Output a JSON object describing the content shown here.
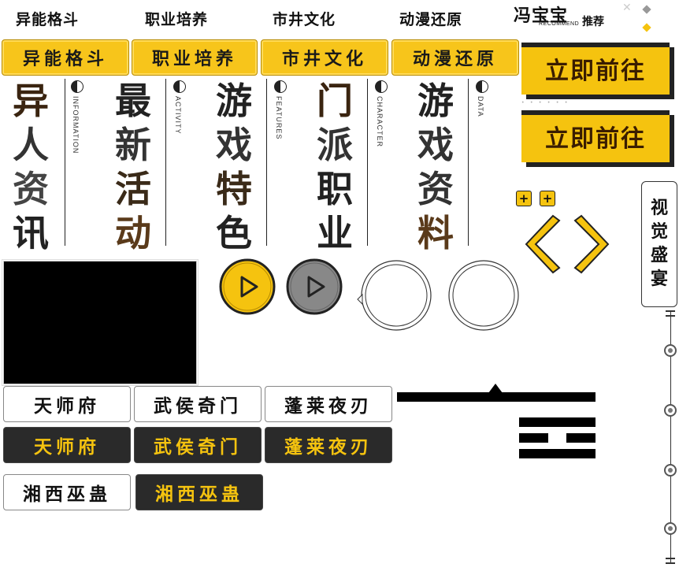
{
  "top_nav": {
    "items": [
      "异能格斗",
      "职业培养",
      "市井文化",
      "动漫还原"
    ]
  },
  "brand": {
    "name": "冯宝宝",
    "sub": "RECOMMEND",
    "tag": "推荐"
  },
  "tabs": {
    "items": [
      "异能格斗",
      "职业培养",
      "市井文化",
      "动漫还原"
    ]
  },
  "actions": {
    "go_primary": "立即前往",
    "go_secondary": "立即前往"
  },
  "categories": [
    {
      "title": [
        "异",
        "人",
        "资",
        "讯"
      ],
      "label": "INFORMATION"
    },
    {
      "title": [
        "最",
        "新",
        "活",
        "动"
      ],
      "label": "ACTIVITY"
    },
    {
      "title": [
        "游",
        "戏",
        "特",
        "色"
      ],
      "label": "FEATURES"
    },
    {
      "title": [
        "门",
        "派",
        "职",
        "业"
      ],
      "label": "CHARACTER"
    },
    {
      "title": [
        "游",
        "戏",
        "资",
        "料"
      ],
      "label": "DATA"
    }
  ],
  "visual_feast": {
    "chars": [
      "视",
      "觉",
      "盛",
      "宴"
    ]
  },
  "sects": {
    "light_row": [
      "天师府",
      "武侯奇门",
      "蓬莱夜刃"
    ],
    "dark_row": [
      "天师府",
      "武侯奇门",
      "蓬莱夜刃"
    ],
    "light_single": "湘西巫蛊",
    "dark_single": "湘西巫蛊"
  },
  "icons": {
    "plus": "plus-icon",
    "prev": "chevron-left-icon",
    "next": "chevron-right-icon",
    "play": "play-icon",
    "yin_yang": "yin-yang-icon"
  },
  "colors": {
    "accent": "#f5c30f",
    "dark": "#2a2a2a",
    "text": "#111111",
    "brown_gradient_end": "#5a3a1a"
  }
}
